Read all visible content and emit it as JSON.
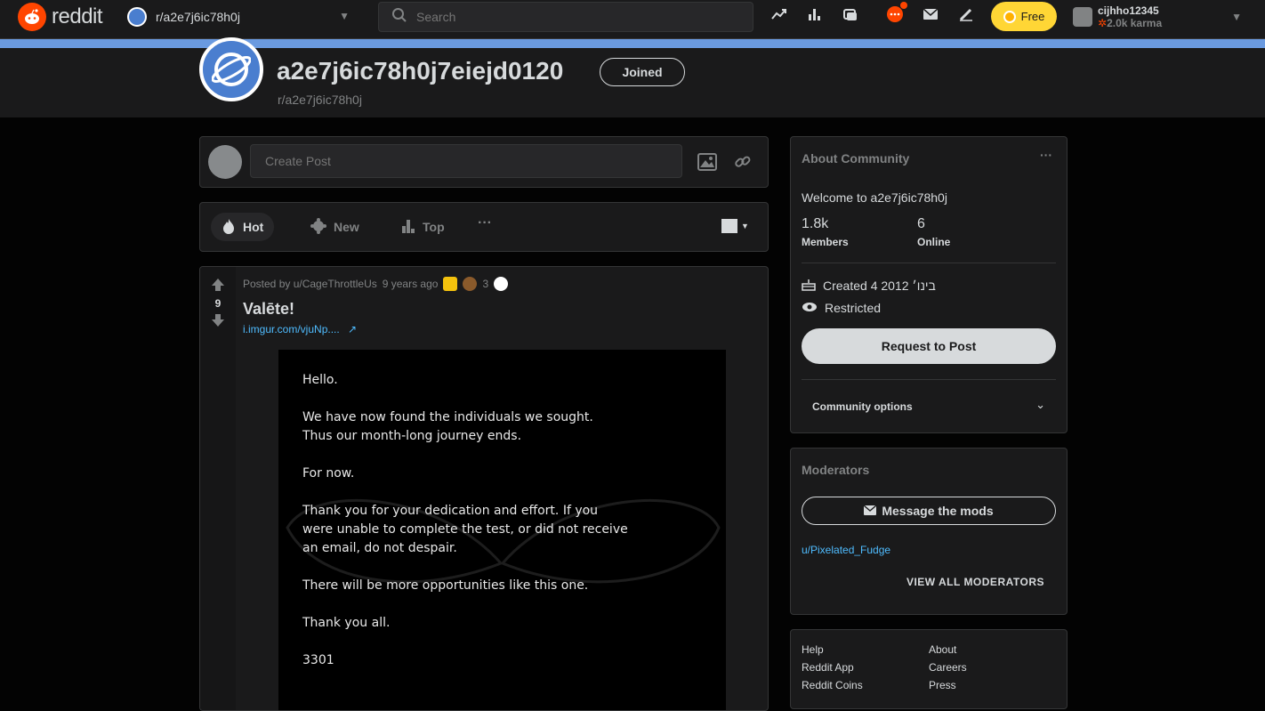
{
  "nav": {
    "logo_text": "reddit",
    "community_switch": "r/a2e7j6ic78h0j",
    "search_placeholder": "Search",
    "free_label": "Free",
    "username": "cijhho12345",
    "karma": "2.0k karma"
  },
  "subreddit": {
    "title": "a2e7j6ic78h0j7eiejd0120",
    "name": "r/a2e7j6ic78h0j",
    "joined_label": "Joined"
  },
  "create_post": {
    "placeholder": "Create Post"
  },
  "sort": {
    "hot": "Hot",
    "new": "New",
    "top": "Top",
    "more": "···"
  },
  "post": {
    "votes": "9",
    "posted_by": "Posted by u/CageThrottleUs",
    "age": "9 years ago",
    "award_count": "3",
    "title": "Valēte!",
    "link": "i.imgur.com/vjuNp....",
    "image_text": "Hello.\n\nWe have now found the individuals we sought.\nThus our month-long journey ends.\n\nFor now.\n\nThank you for your dedication and effort.  If you\nwere unable to complete the test, or did not receive\nan email, do not despair.\n\nThere will be more opportunities like this one.\n\nThank you all.\n\n3301"
  },
  "about": {
    "header": "About Community",
    "welcome": "Welcome to a2e7j6ic78h0j",
    "members_count": "1.8k",
    "members_label": "Members",
    "online_count": "6",
    "online_label": "Online",
    "created": "Created 4 בינו׳ 2012",
    "restricted": "Restricted",
    "request_btn": "Request to Post",
    "community_options": "Community options"
  },
  "moderators": {
    "header": "Moderators",
    "message_btn": "Message the mods",
    "mod_user": "u/Pixelated_Fudge",
    "view_all": "VIEW ALL MODERATORS"
  },
  "footer": {
    "links_left": [
      "Help",
      "Reddit App",
      "Reddit Coins"
    ],
    "links_right": [
      "About",
      "Careers",
      "Press"
    ]
  },
  "colors": {
    "accent": "#ff4500",
    "link": "#4fbcff",
    "banner": "#6a9ae0",
    "free_btn": "#ffd635"
  }
}
